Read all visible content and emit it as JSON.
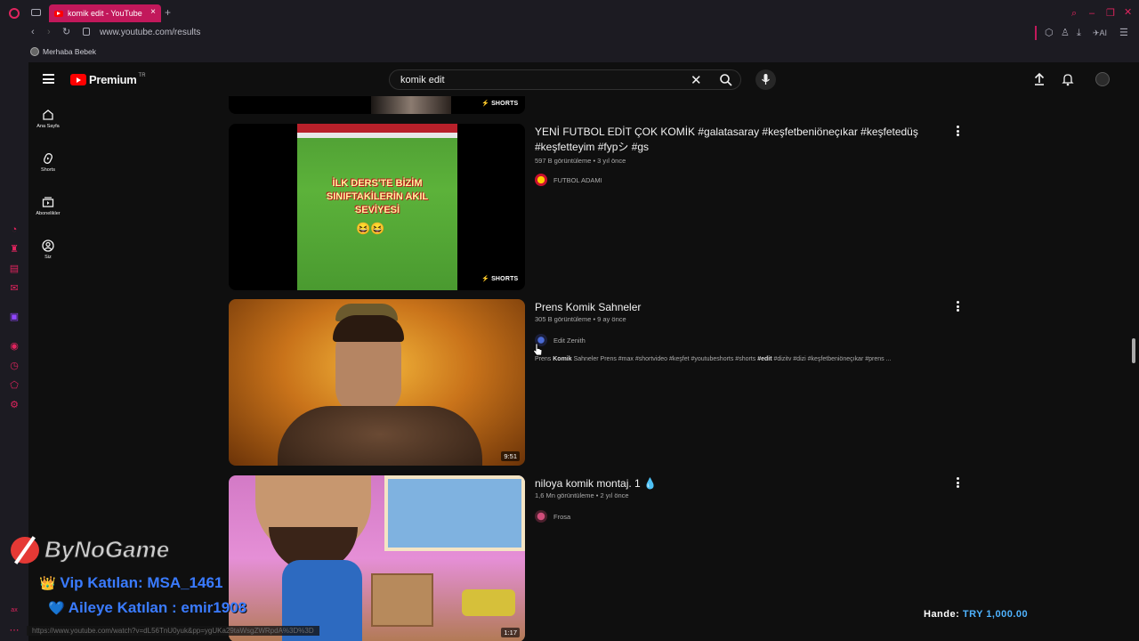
{
  "browser": {
    "tab_title": "komik edit - YouTube",
    "url": "www.youtube.com/results",
    "bookmark": "Merhaba Bebek",
    "ai_label": "AI",
    "status_url": "https://www.youtube.com/watch?v=dL56TnU0yuk&pp=ygUKa29taWsgZWRpdA%3D%3D"
  },
  "youtube": {
    "logo_text": "Premium",
    "region": "TR",
    "search_value": "komik edit",
    "sidebar": [
      {
        "label": "Ana Sayfa",
        "icon": "home-icon"
      },
      {
        "label": "Shorts",
        "icon": "shorts-icon"
      },
      {
        "label": "Abonelikler",
        "icon": "subscriptions-icon"
      },
      {
        "label": "Siz",
        "icon": "account-icon"
      }
    ],
    "shorts_label": "SHORTS",
    "results": [
      {
        "title": "YENİ FUTBOL EDİT ÇOK KOMİK #galatasaray #keşfetbeniöneçıkar #keşfetedüş #keşfetteyim #fypシ #gs",
        "meta": "597 B görüntüleme • 3 yıl önce",
        "channel": "FUTBOL ADAMI",
        "thumb_text": "İLK DERS'TE BİZİM SINIFTAKİLERİN AKIL SEVİYESİ",
        "is_short": true
      },
      {
        "title": "Prens Komik Sahneler",
        "meta": "305 B görüntüleme • 9 ay önce",
        "channel": "Edit Zenith",
        "desc_pre": "Prens ",
        "desc_bold": "Komik",
        "desc_mid": " Sahneler Prens #max #shortvideo #keşfet #youtubeshorts #shorts ",
        "desc_bold2": "#edit",
        "desc_post": " #dizitv #dizi #keşfetbeniöneçıkar #prens ...",
        "duration": "9:51"
      },
      {
        "title": "niloya komik montaj. 1 💧",
        "meta": "1,6 Mn görüntüleme • 2 yıl önce",
        "channel": "Frosa",
        "duration": "1:17"
      }
    ]
  },
  "overlay": {
    "brand": "ByNoGame",
    "vip_line": "Vip Katılan: MSA_1461",
    "family_line": "Aileye Katılan : emir1908",
    "donation_label": "Hande:",
    "donation_amount": "TRY 1,000.00",
    "corner_label": "ax"
  },
  "colors": {
    "accent": "#c2185b",
    "yt_red": "#ff0000",
    "opera_red": "#e0245e"
  }
}
